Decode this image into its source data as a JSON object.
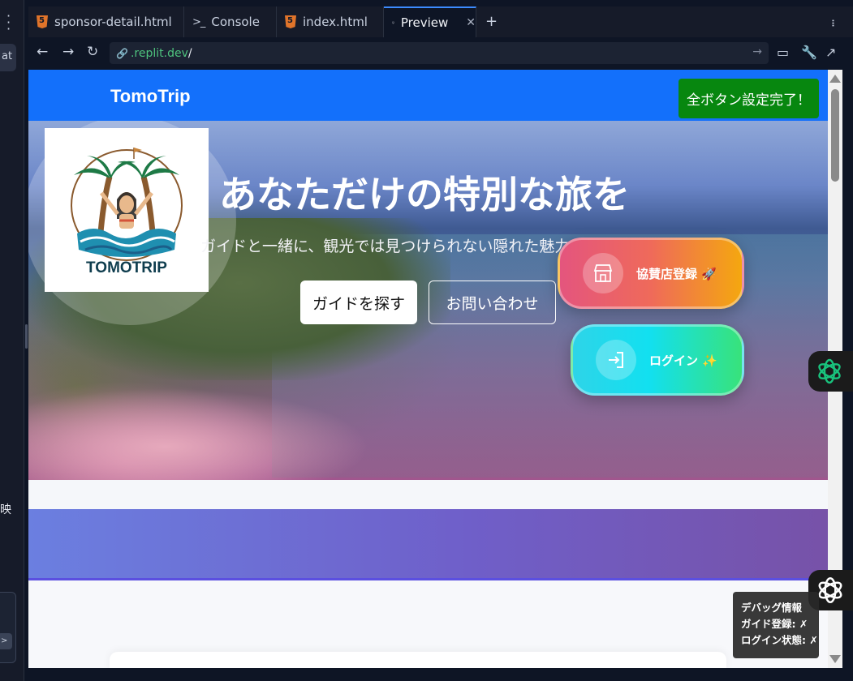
{
  "left_panel": {
    "at_label": "at",
    "side_char": "映",
    "send_label": ">"
  },
  "tabs": [
    {
      "label": "sponsor-detail.html",
      "icon": "html5-icon"
    },
    {
      "label": "Console",
      "icon": "console-icon"
    },
    {
      "label": "index.html",
      "icon": "html5-icon"
    },
    {
      "label": "Preview",
      "icon": "monitor-icon",
      "active": true,
      "close": "✕"
    }
  ],
  "tab_add": "+",
  "address": {
    "host": ".replit.dev",
    "path": "/"
  },
  "site": {
    "brand": "TomoTrip",
    "done_button": "全ボタン設定完了！",
    "logo_text": "TOMOTRIP",
    "hero_title": "あなただけの特別な旅を",
    "hero_subtitle": "ガイドと一緒に、観光では見つけられない隠れた魅力",
    "find_guide": "ガイドを探す",
    "contact": "お問い合わせ",
    "sponsor_register": "協賛店登録 🚀",
    "login": "ログイン ✨"
  },
  "debug": {
    "title": "デバッグ情報",
    "guide_reg": "ガイド登録: ✗",
    "login_state": "ログイン状態: ✗"
  },
  "colors": {
    "header_blue": "#1370fb",
    "done_green": "#07870f",
    "url_host_green": "#4ec37e",
    "tab_accent": "#3d8bfd"
  }
}
